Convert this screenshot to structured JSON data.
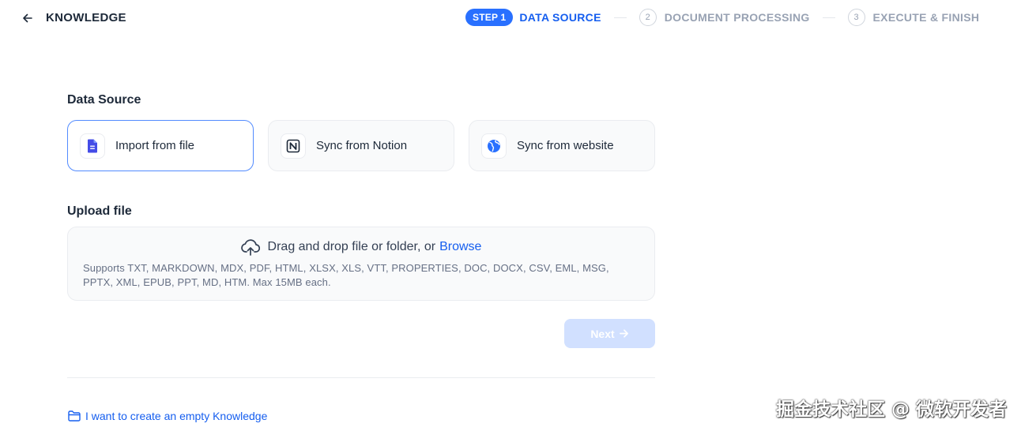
{
  "header": {
    "title": "KNOWLEDGE",
    "steps": {
      "active_badge": "STEP 1",
      "active_label": "DATA SOURCE",
      "step2_num": "2",
      "step2_label": "DOCUMENT PROCESSING",
      "step3_num": "3",
      "step3_label": "EXECUTE & FINISH"
    }
  },
  "data_source": {
    "title": "Data Source",
    "options": [
      {
        "label": "Import from file",
        "icon": "file-icon",
        "selected": true
      },
      {
        "label": "Sync from Notion",
        "icon": "notion-icon",
        "selected": false
      },
      {
        "label": "Sync from website",
        "icon": "globe-icon",
        "selected": false
      }
    ]
  },
  "upload": {
    "title": "Upload file",
    "drag_text": "Drag and drop file or folder, or",
    "browse": "Browse",
    "supports": "Supports TXT, MARKDOWN, MDX, PDF, HTML, XLSX, XLS, VTT, PROPERTIES, DOC, DOCX, CSV, EML, MSG, PPTX, XML, EPUB, PPT, MD, HTM. Max 15MB each."
  },
  "next_button": "Next",
  "empty_knowledge_link": "I want to create an empty Knowledge",
  "watermark": "掘金技术社区 @ 微软开发者",
  "colors": {
    "accent": "#155eef",
    "badge": "#2970ff",
    "next_disabled": "#d1e0ff"
  }
}
